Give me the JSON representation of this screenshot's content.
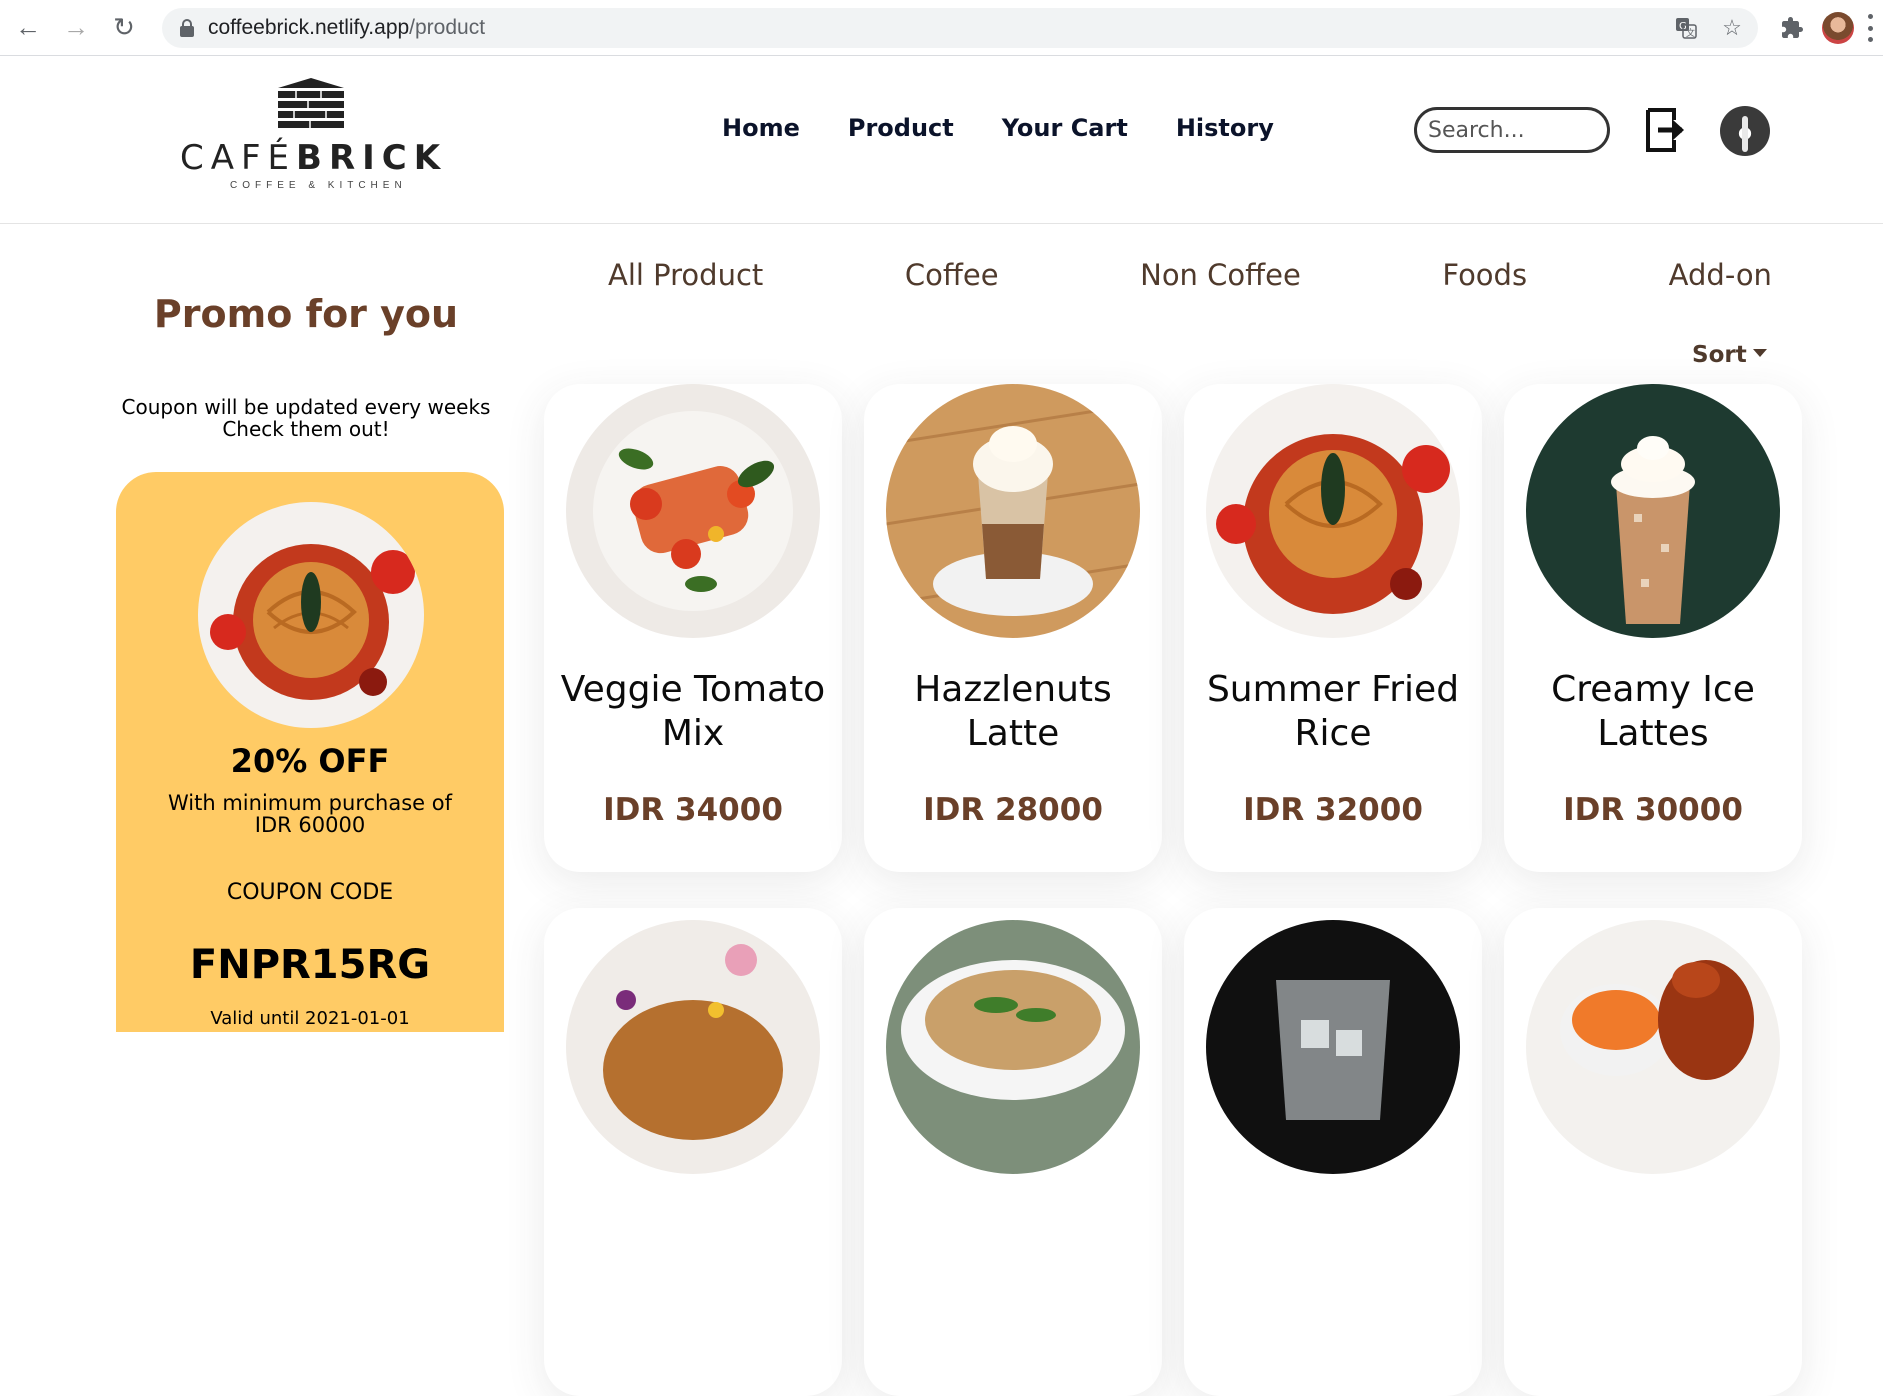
{
  "browser": {
    "url_host": "coffeebrick.netlify.app",
    "url_path": "/product",
    "back_icon": "arrow-left",
    "forward_icon": "arrow-right",
    "reload_icon": "reload",
    "translate_icon": "translate",
    "bookmark_icon": "star",
    "extensions_icon": "puzzle"
  },
  "header": {
    "logo_word_thin": "CAFÉ",
    "logo_word_bold": "BRICK",
    "logo_subtitle": "COFFEE & KITCHEN",
    "nav": [
      "Home",
      "Product",
      "Your Cart",
      "History"
    ],
    "search_placeholder": "Search..."
  },
  "promo": {
    "title": "Promo for you",
    "note_line1": "Coupon will be updated every weeks",
    "note_line2": "Check them out!",
    "coupon": {
      "discount": "20% OFF",
      "description": "With minimum purchase of IDR 60000",
      "code_label": "COUPON CODE",
      "code": "FNPR15RG",
      "valid": "Valid until 2021-01-01"
    }
  },
  "categories": [
    "All Product",
    "Coffee",
    "Non Coffee",
    "Foods",
    "Add-on"
  ],
  "sort_label": "Sort",
  "products": [
    {
      "name": "Veggie Tomato Mix",
      "price": "IDR 34000"
    },
    {
      "name": "Hazzlenuts Latte",
      "price": "IDR 28000"
    },
    {
      "name": "Summer Fried Rice",
      "price": "IDR 32000"
    },
    {
      "name": "Creamy Ice Lattes",
      "price": "IDR 30000"
    }
  ],
  "colors": {
    "brand_brown": "#6a4029",
    "coupon_yellow": "#ffcb65",
    "nav_text": "#0b132a"
  }
}
